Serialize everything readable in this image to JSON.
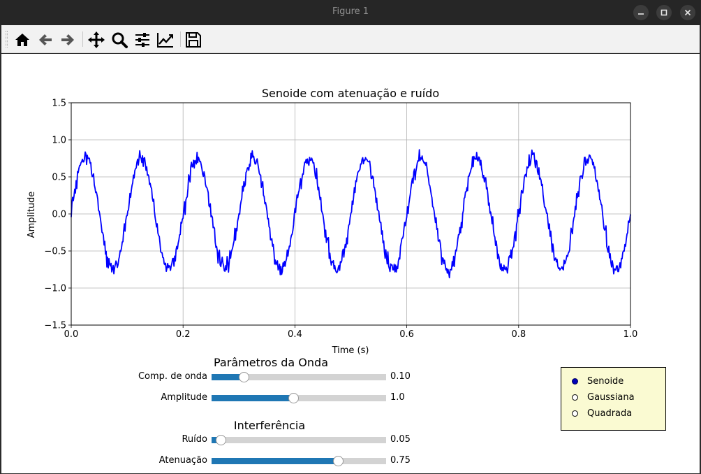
{
  "window": {
    "title": "Figure 1"
  },
  "toolbar": {
    "buttons": [
      "home-icon",
      "back-arrow-icon",
      "forward-arrow-icon",
      "pan-icon",
      "zoom-icon",
      "configure-subplots-icon",
      "edit-axis-icon",
      "save-icon"
    ]
  },
  "chart_data": {
    "type": "line",
    "title": "Senoide com atenuação e ruído",
    "xlabel": "Time (s)",
    "ylabel": "Amplitude",
    "xlim": [
      0.0,
      1.0
    ],
    "ylim": [
      -1.5,
      1.5
    ],
    "xticks": [
      "0.0",
      "0.2",
      "0.4",
      "0.6",
      "0.8",
      "1.0"
    ],
    "yticks": [
      "−1.5",
      "−1.0",
      "−0.5",
      "0.0",
      "0.5",
      "1.0",
      "1.5"
    ],
    "grid": true,
    "series": [
      {
        "color": "#0000ff",
        "wavelength": 0.1,
        "amplitude": 1.0,
        "attenuation": 0.75,
        "noise": 0.05,
        "points": 801
      }
    ]
  },
  "controls": {
    "section1_title": "Parâmetros da Onda",
    "section2_title": "Interferência",
    "sliders": [
      {
        "label": "Comp. de onda",
        "value": "0.10",
        "fraction": 0.185
      },
      {
        "label": "Amplitude",
        "value": "1.0",
        "fraction": 0.47
      },
      {
        "label": "Ruído",
        "value": "0.05",
        "fraction": 0.055
      },
      {
        "label": "Atenuação",
        "value": "0.75",
        "fraction": 0.725
      }
    ],
    "fill_color": "#1f77b4",
    "radio": {
      "options": [
        "Senoide",
        "Gaussiana",
        "Quadrada"
      ],
      "selected": "Senoide",
      "background": "#fafad2"
    }
  }
}
